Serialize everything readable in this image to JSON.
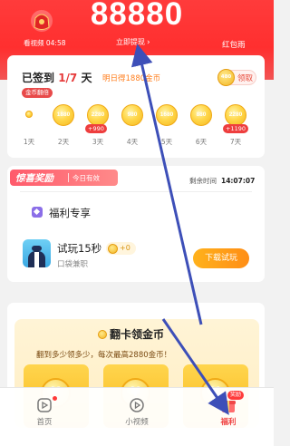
{
  "header": {
    "watch_text": "看视频 04:58",
    "coin_balance": "88880",
    "withdraw_label": "立即提现",
    "withdraw_chevron": "›",
    "redpack_label": "红包雨"
  },
  "signin": {
    "title_prefix": "已签到 ",
    "progress": "1/7",
    "title_suffix": " 天",
    "subtitle": "明日得1880金币",
    "claim_coin": "480",
    "claim_label": "领取",
    "double_badge": "金币翻倍",
    "days": [
      {
        "label": "1天",
        "coin": "",
        "bonus": ""
      },
      {
        "label": "2天",
        "coin": "1880",
        "bonus": ""
      },
      {
        "label": "3天",
        "coin": "2280",
        "bonus": "+990"
      },
      {
        "label": "4天",
        "coin": "980",
        "bonus": ""
      },
      {
        "label": "5天",
        "coin": "1680",
        "bonus": ""
      },
      {
        "label": "6天",
        "coin": "880",
        "bonus": ""
      },
      {
        "label": "7天",
        "coin": "2280",
        "bonus": "+1190"
      }
    ]
  },
  "reward": {
    "title": "惊喜奖励",
    "subtitle": "今日有效",
    "remain_label": "剩余时间",
    "remain_time": "14:07:07",
    "vip_label": "福利专享",
    "trial_title": "试玩15秒",
    "trial_reward": "+0",
    "trial_sub": "口袋兼职",
    "download_label": "下载试玩"
  },
  "flip": {
    "title": "翻卡领金币",
    "subtitle": "翻到多少领多少，每次最高2880金币！",
    "card_symbol": "¥"
  },
  "nav": {
    "items": [
      {
        "label": "首页"
      },
      {
        "label": "小视频"
      },
      {
        "label": "福利",
        "badge": "奖励"
      }
    ]
  },
  "colors": {
    "header_red": "#ff3b3b",
    "accent_orange": "#ff8d15",
    "coin_gold": "#f5b81f",
    "arrow_blue": "#3d4fb8"
  },
  "icons": [
    "red-pouch-icon",
    "vip-icon",
    "app-icon",
    "coin-icon",
    "home-icon",
    "video-icon",
    "gift-icon"
  ]
}
